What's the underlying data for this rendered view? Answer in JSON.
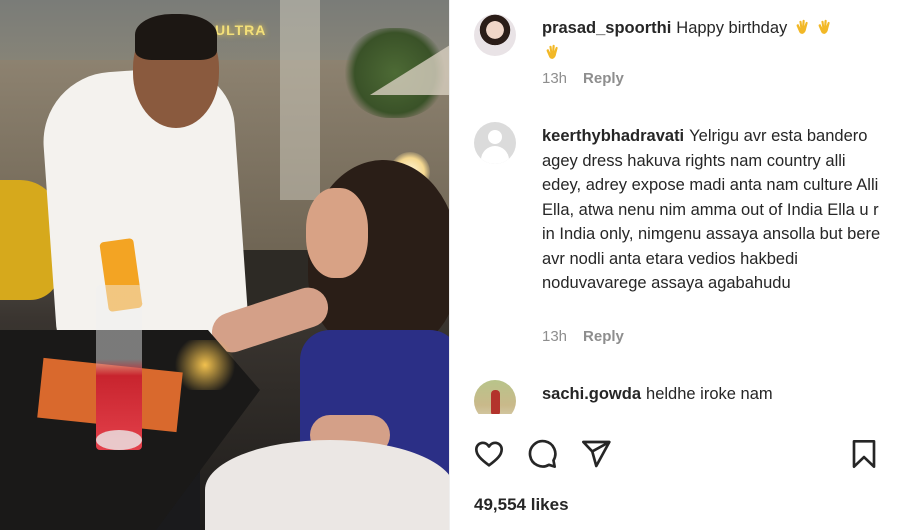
{
  "photo": {
    "sign_text": "ULTRA"
  },
  "comments": [
    {
      "username": "prasad_spoorthi",
      "text": "Happy birthday",
      "time": "13h",
      "reply_label": "Reply"
    },
    {
      "username": "keerthybhadravati",
      "text": "Yelrigu avr esta bandero agey dress hakuva rights nam country alli edey, adrey expose madi anta nam culture Alli Ella, atwa nenu nim amma out of India Ella u r in India only, nimgenu assaya ansolla but bere avr nodli anta etara vedios hakbedi noduvavarege assaya agabahudu",
      "time": "13h",
      "reply_label": "Reply"
    },
    {
      "username": "sachi.gowda",
      "text": "heldhe iroke nam"
    }
  ],
  "actions": {
    "like_icon": "heart-icon",
    "comment_icon": "comment-icon",
    "share_icon": "send-icon",
    "save_icon": "bookmark-icon"
  },
  "likes": "49,554 likes",
  "colors": {
    "text": "#262626",
    "muted": "#8e8e8e",
    "clap": "#f2b827"
  }
}
